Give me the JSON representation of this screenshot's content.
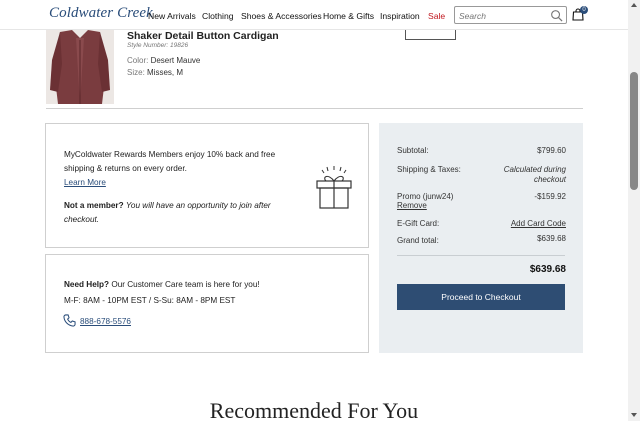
{
  "header": {
    "logo": "Coldwater Creek",
    "nav": [
      "New Arrivals",
      "Clothing",
      "Shoes & Accessories",
      "Home & Gifts",
      "Inspiration",
      "Sale"
    ],
    "search_placeholder": "Search",
    "bag_count": "0"
  },
  "product": {
    "name": "Shaker Detail Button Cardigan",
    "style_number": "Style Number: 19826",
    "color_label": "Color:",
    "color_value": "Desert Mauve",
    "size_label": "Size:",
    "size_value": "Misses, M"
  },
  "rewards": {
    "line1": "MyColdwater Rewards Members enjoy 10% back and free",
    "line2": "shipping & returns on every order.",
    "learn_more": "Learn More",
    "not_member_bold": "Not a member?",
    "not_member_rest": "You will have an opportunity to join after",
    "not_member_rest2": "checkout."
  },
  "help": {
    "need_help_bold": "Need Help?",
    "need_help_rest": "Our Customer Care team is here for you!",
    "hours": "M-F: 8AM - 10PM EST / S-Su: 8AM - 8PM EST",
    "phone": "888-678-5576"
  },
  "summary": {
    "subtotal_label": "Subtotal:",
    "subtotal_value": "$799.60",
    "shipping_label": "Shipping & Taxes:",
    "shipping_value_1": "Calculated during",
    "shipping_value_2": "checkout",
    "promo_label": "Promo (junw24)",
    "promo_remove": "Remove",
    "promo_value": "-$159.92",
    "egift_label": "E-Gift Card:",
    "egift_link": "Add Card Code",
    "grand_label": "Grand total:",
    "grand_value": "$639.68",
    "total_bold": "$639.68",
    "checkout_button": "Proceed to Checkout"
  },
  "recommended_title": "Recommended For You",
  "colors": {
    "brand_blue": "#2a4d7a",
    "button_blue": "#2e4d73",
    "sale_red": "#c0171f",
    "summary_bg": "#eaeef1"
  }
}
